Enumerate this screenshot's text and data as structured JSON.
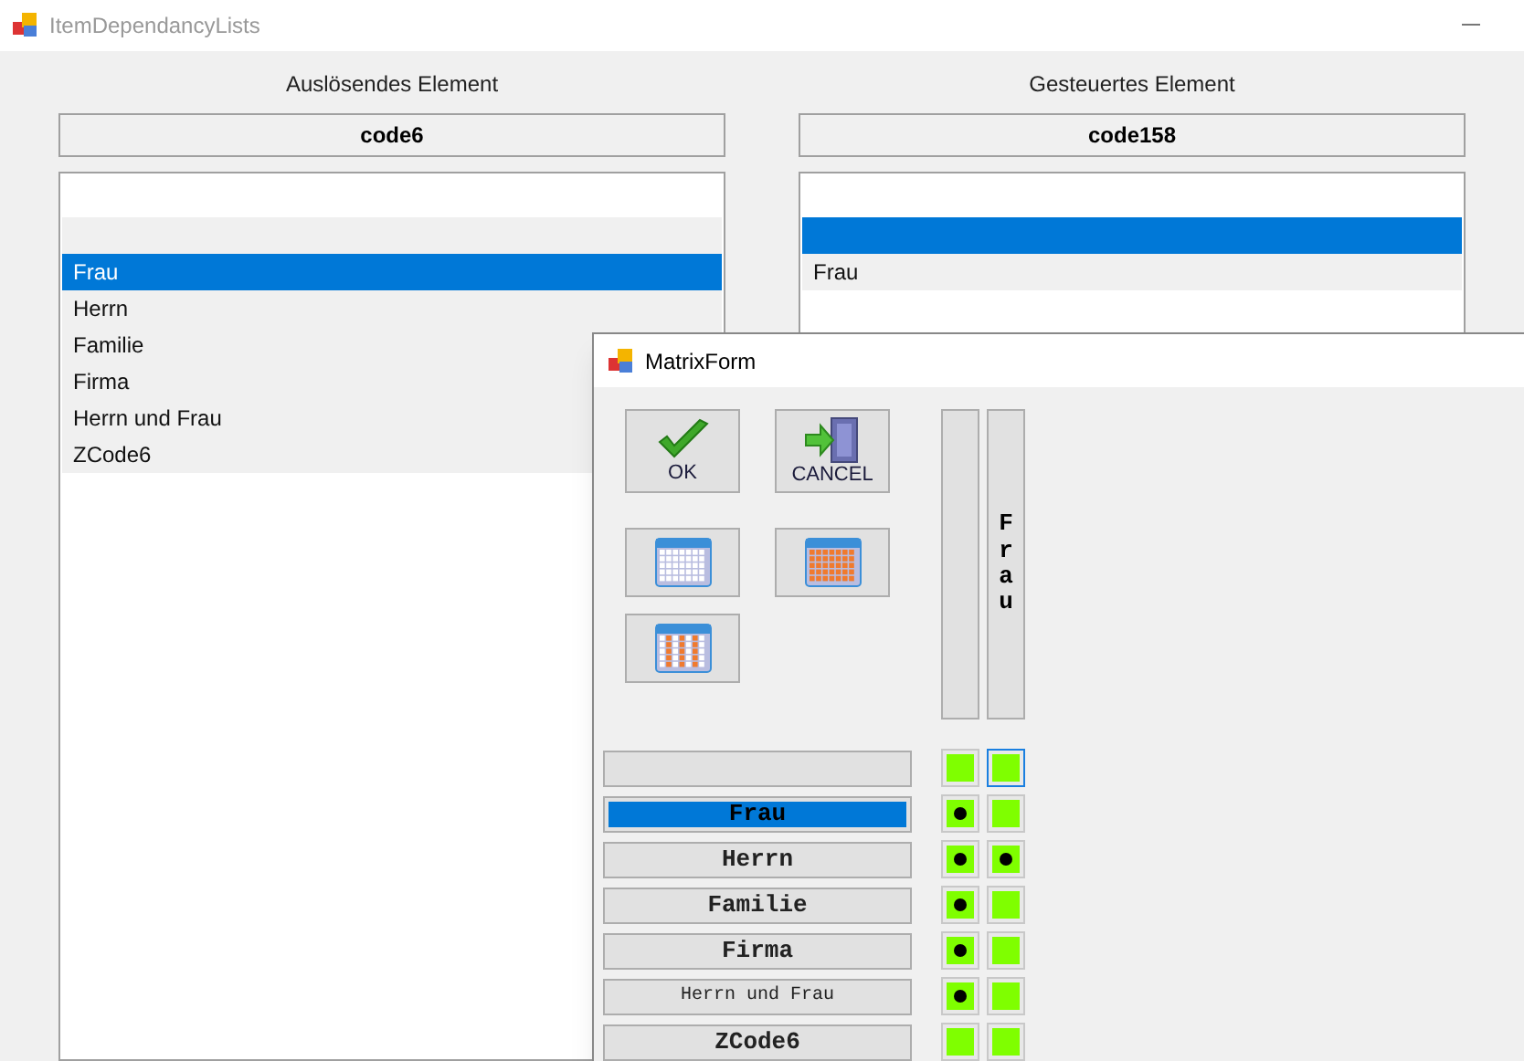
{
  "window": {
    "title": "ItemDependancyLists"
  },
  "trigger": {
    "heading": "Auslösendes Element",
    "code": "code6",
    "items": [
      {
        "selected": false
      },
      {
        "label": "Frau",
        "selected": true
      },
      {
        "label": "Herrn",
        "selected": false
      },
      {
        "label": "Familie",
        "selected": false
      },
      {
        "label": "Firma",
        "selected": false
      },
      {
        "label": "Herrn und Frau",
        "selected": false
      },
      {
        "label": "ZCode6",
        "selected": false
      }
    ]
  },
  "controlled": {
    "heading": "Gesteuertes Element",
    "code": "code158",
    "items": [
      {
        "selected": true
      },
      {
        "label": "Frau",
        "selected": false
      }
    ]
  },
  "matrix_form": {
    "title": "MatrixForm",
    "buttons": [
      {
        "kind": "ok",
        "label": "OK"
      },
      {
        "kind": "cancel",
        "label": "CANCEL"
      }
    ],
    "tools": [
      {
        "kind": "grid-plain"
      },
      {
        "kind": "grid-filled"
      },
      {
        "kind": "grid-columns"
      }
    ],
    "columns": [
      {},
      {
        "label": "Frau"
      }
    ],
    "rows": [
      {
        "selected": false,
        "cells": [
          {
            "checked": false,
            "focused": false
          },
          {
            "checked": false,
            "focused": true
          }
        ]
      },
      {
        "label": "Frau",
        "selected": true,
        "small": false,
        "cells": [
          {
            "checked": true,
            "focused": false
          },
          {
            "checked": false,
            "focused": false
          }
        ]
      },
      {
        "label": "Herrn",
        "selected": false,
        "small": false,
        "cells": [
          {
            "checked": true,
            "focused": false
          },
          {
            "checked": true,
            "focused": false
          }
        ]
      },
      {
        "label": "Familie",
        "selected": false,
        "small": false,
        "cells": [
          {
            "checked": true,
            "focused": false
          },
          {
            "checked": false,
            "focused": false
          }
        ]
      },
      {
        "label": "Firma",
        "selected": false,
        "small": false,
        "cells": [
          {
            "checked": true,
            "focused": false
          },
          {
            "checked": false,
            "focused": false
          }
        ]
      },
      {
        "label": "Herrn und Frau",
        "selected": false,
        "small": true,
        "cells": [
          {
            "checked": true,
            "focused": false
          },
          {
            "checked": false,
            "focused": false
          }
        ]
      },
      {
        "label": "ZCode6",
        "selected": false,
        "small": false,
        "cells": [
          {
            "checked": false,
            "focused": false
          },
          {
            "checked": false,
            "focused": false
          }
        ]
      }
    ]
  }
}
